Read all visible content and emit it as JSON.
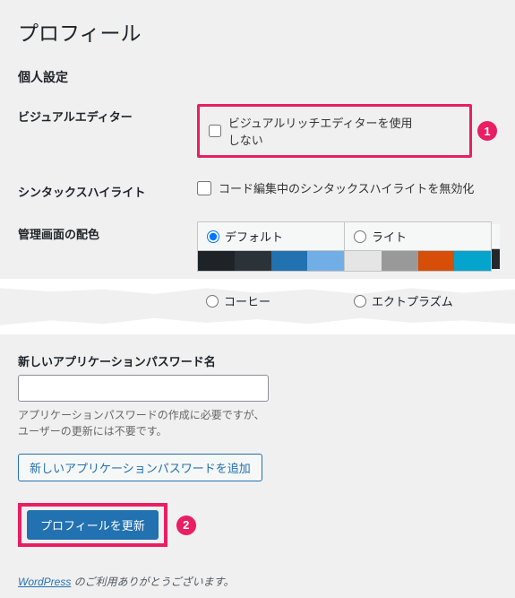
{
  "page_title": "プロフィール",
  "section_personal": "個人設定",
  "rows": {
    "visual_editor": {
      "label": "ビジュアルエディター",
      "checkbox_label": "ビジュアルリッチエディターを使用しない"
    },
    "syntax": {
      "label": "シンタックスハイライト",
      "checkbox_label": "コード編集中のシンタックスハイライトを無効化"
    },
    "admin_color": {
      "label": "管理画面の配色"
    }
  },
  "schemes": {
    "default": {
      "name": "デフォルト",
      "colors": [
        "#1d2327",
        "#2c3338",
        "#2271b1",
        "#72aee6"
      ]
    },
    "light": {
      "name": "ライト",
      "colors": [
        "#e5e5e5",
        "#999999",
        "#d64e07",
        "#04a4cc"
      ]
    },
    "coffee": {
      "name": "コーヒー"
    },
    "ecto": {
      "name": "エクトプラズム"
    }
  },
  "badges": {
    "one": "1",
    "two": "2"
  },
  "app_password": {
    "label": "新しいアプリケーションパスワード名",
    "helper1": "アプリケーションパスワードの作成に必要ですが、",
    "helper2": "ユーザーの更新には不要です。",
    "add_button": "新しいアプリケーションパスワードを追加"
  },
  "submit_button": "プロフィールを更新",
  "footer": {
    "link": "WordPress",
    "text": " のご利用ありがとうございます。"
  }
}
